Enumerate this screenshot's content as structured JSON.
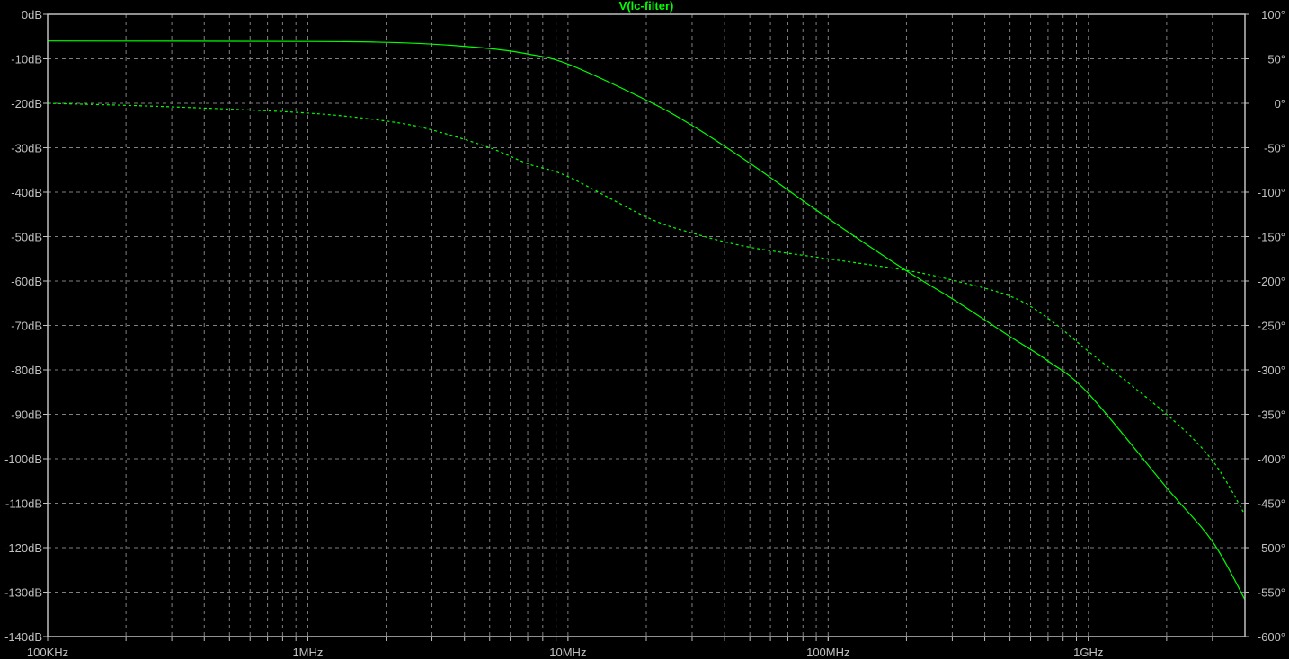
{
  "chart_data": {
    "type": "line",
    "title": "V(lc-filter)",
    "xscale": "log",
    "xlim_hz": [
      100000,
      4000000000
    ],
    "ylim_db": [
      -140,
      0
    ],
    "ylim_deg": [
      -600,
      100
    ],
    "grid": true,
    "x_ticks": [
      {
        "value": 100000,
        "label": "100KHz"
      },
      {
        "value": 1000000,
        "label": "1MHz"
      },
      {
        "value": 10000000,
        "label": "10MHz"
      },
      {
        "value": 100000000,
        "label": "100MHz"
      },
      {
        "value": 1000000000,
        "label": "1GHz"
      }
    ],
    "y_left_ticks": [
      {
        "value": 0,
        "label": "0dB"
      },
      {
        "value": -10,
        "label": "-10dB"
      },
      {
        "value": -20,
        "label": "-20dB"
      },
      {
        "value": -30,
        "label": "-30dB"
      },
      {
        "value": -40,
        "label": "-40dB"
      },
      {
        "value": -50,
        "label": "-50dB"
      },
      {
        "value": -60,
        "label": "-60dB"
      },
      {
        "value": -70,
        "label": "-70dB"
      },
      {
        "value": -80,
        "label": "-80dB"
      },
      {
        "value": -90,
        "label": "-90dB"
      },
      {
        "value": -100,
        "label": "-100dB"
      },
      {
        "value": -110,
        "label": "-110dB"
      },
      {
        "value": -120,
        "label": "-120dB"
      },
      {
        "value": -130,
        "label": "-130dB"
      },
      {
        "value": -140,
        "label": "-140dB"
      }
    ],
    "y_right_ticks": [
      {
        "value": 100,
        "label": "100°"
      },
      {
        "value": 50,
        "label": "50°"
      },
      {
        "value": 0,
        "label": "0°"
      },
      {
        "value": -50,
        "label": "-50°"
      },
      {
        "value": -100,
        "label": "-100°"
      },
      {
        "value": -150,
        "label": "-150°"
      },
      {
        "value": -200,
        "label": "-200°"
      },
      {
        "value": -250,
        "label": "-250°"
      },
      {
        "value": -300,
        "label": "-300°"
      },
      {
        "value": -350,
        "label": "-350°"
      },
      {
        "value": -400,
        "label": "-400°"
      },
      {
        "value": -450,
        "label": "-450°"
      },
      {
        "value": -500,
        "label": "-500°"
      },
      {
        "value": -550,
        "label": "-550°"
      },
      {
        "value": -600,
        "label": "-600°"
      }
    ],
    "series": [
      {
        "name": "magnitude",
        "unit": "dB",
        "axis": "left",
        "style": "solid",
        "freq_hz": [
          100000,
          1000000,
          2000000,
          3000000,
          5000000,
          7000000,
          10000000,
          20000000,
          30000000,
          50000000,
          100000000,
          200000000,
          300000000,
          500000000,
          700000000,
          1000000000,
          2000000000,
          3000000000,
          4000000000
        ],
        "values": [
          -6.0,
          -6.1,
          -6.3,
          -6.7,
          -7.7,
          -8.9,
          -11.2,
          -19.3,
          -25.0,
          -33.5,
          -45.9,
          -57.7,
          -64.0,
          -72.5,
          -78.0,
          -85.3,
          -106.5,
          -118.6,
          -131.7
        ]
      },
      {
        "name": "phase",
        "unit": "deg",
        "axis": "right",
        "style": "dashed",
        "freq_hz": [
          100000,
          300000,
          1000000,
          2000000,
          3000000,
          5000000,
          7000000,
          10000000,
          20000000,
          30000000,
          50000000,
          100000000,
          200000000,
          300000000,
          500000000,
          700000000,
          1000000000,
          2000000000,
          3000000000,
          4000000000
        ],
        "values": [
          0,
          -4,
          -11,
          -20,
          -30,
          -50,
          -68,
          -82.5,
          -128,
          -146,
          -162,
          -175,
          -188,
          -199,
          -217,
          -242,
          -279,
          -350,
          -402,
          -463
        ]
      }
    ],
    "colors": {
      "background": "#000000",
      "grid": "#808080",
      "axis": "#c0c0c0",
      "trace": "#00ff00"
    }
  }
}
